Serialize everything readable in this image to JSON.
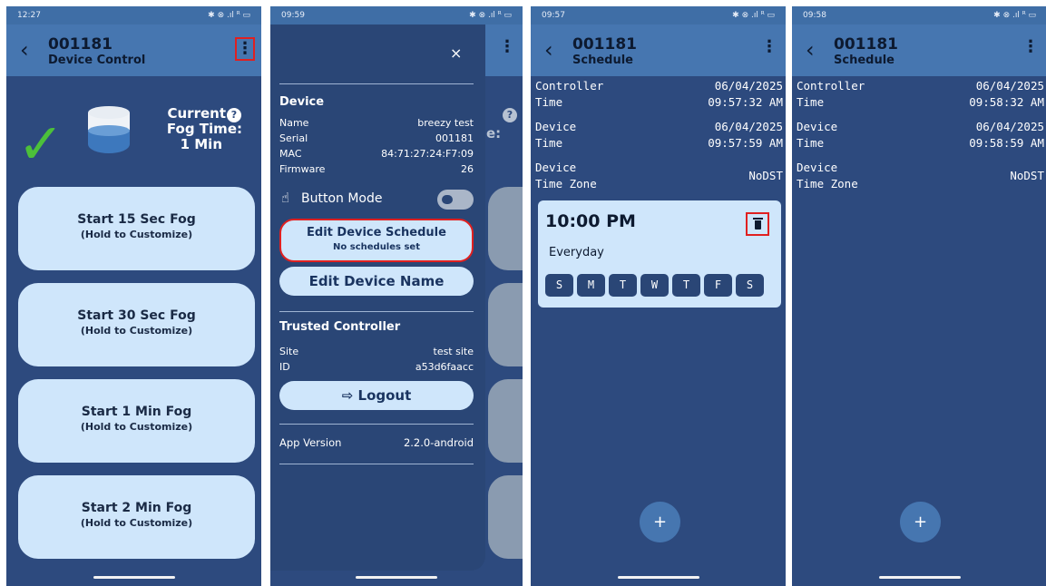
{
  "panel1": {
    "status": {
      "time": "12:27",
      "icons": "⧈ ⧈",
      "right": "✱ ⊗ .ıl ᴿ ▭"
    },
    "header": {
      "id": "001181",
      "subtitle": "Device Control",
      "menu": "⋮",
      "back": "‹"
    },
    "fog": {
      "line1": "Current",
      "line2": "Fog Time:",
      "line3": "1 Min",
      "help": "?",
      "check": "✓"
    },
    "buttons": [
      {
        "main": "Start 15 Sec Fog",
        "sub": "(Hold to Customize)"
      },
      {
        "main": "Start 30 Sec Fog",
        "sub": "(Hold to Customize)"
      },
      {
        "main": "Start 1 Min Fog",
        "sub": "(Hold to Customize)"
      },
      {
        "main": "Start 2 Min Fog",
        "sub": "(Hold to Customize)"
      }
    ]
  },
  "panel2": {
    "status": {
      "time": "09:59",
      "icons": "⧈ ⧈",
      "right": "✱ ⊗ .ıl ᴿ ▭"
    },
    "close": "×",
    "menu": "⋮",
    "peek_text": "e:",
    "peek_help": "?",
    "device": {
      "title": "Device",
      "rows": [
        {
          "k": "Name",
          "v": "breezy test"
        },
        {
          "k": "Serial",
          "v": "001181"
        },
        {
          "k": "MAC",
          "v": "84:71:27:24:F7:09"
        },
        {
          "k": "Firmware",
          "v": "26"
        }
      ]
    },
    "button_mode": {
      "icon": "☝",
      "label": "Button Mode"
    },
    "edit_schedule": {
      "label": "Edit Device Schedule",
      "sub": "No schedules set"
    },
    "edit_name": {
      "label": "Edit Device Name"
    },
    "trusted": {
      "title": "Trusted Controller",
      "rows": [
        {
          "k": "Site",
          "v": "test site"
        },
        {
          "k": "ID",
          "v": "a53d6faacc"
        }
      ]
    },
    "logout": {
      "label": "⇨ Logout"
    },
    "app_version": {
      "k": "App Version",
      "v": "2.2.0-android"
    }
  },
  "panel3": {
    "status": {
      "time": "09:57",
      "icons": "⧈ ⧈",
      "right": "✱ ⊗ .ıl ᴿ ▭"
    },
    "header": {
      "id": "001181",
      "subtitle": "Schedule",
      "menu": "⋮",
      "back": "‹"
    },
    "controller": {
      "l1": "Controller",
      "v1": "06/04/2025",
      "l2": "Time",
      "v2": "09:57:32 AM"
    },
    "device": {
      "l1": "Device",
      "v1": "06/04/2025",
      "l2": "Time",
      "v2": "09:57:59 AM"
    },
    "tz": {
      "l1": "Device",
      "l2": "Time Zone",
      "v": "NoDST"
    },
    "schedule": {
      "time": "10:00 PM",
      "repeat": "Everyday",
      "days": [
        "S",
        "M",
        "T",
        "W",
        "T",
        "F",
        "S"
      ]
    },
    "fab": "+"
  },
  "panel4": {
    "status": {
      "time": "09:58",
      "icons": "⧈ ⧈",
      "right": "✱ ⊗ .ıl ᴿ ▭"
    },
    "header": {
      "id": "001181",
      "subtitle": "Schedule",
      "menu": "⋮",
      "back": "‹"
    },
    "controller": {
      "l1": "Controller",
      "v1": "06/04/2025",
      "l2": "Time",
      "v2": "09:58:32 AM"
    },
    "device": {
      "l1": "Device",
      "v1": "06/04/2025",
      "l2": "Time",
      "v2": "09:58:59 AM"
    },
    "tz": {
      "l1": "Device",
      "l2": "Time Zone",
      "v": "NoDST"
    },
    "fab": "+"
  },
  "colors": {
    "background": "#2d4a7e",
    "appbar": "#4676b0",
    "button": "#cfe6fb",
    "highlight": "#e02020",
    "check": "#4cc03a"
  }
}
